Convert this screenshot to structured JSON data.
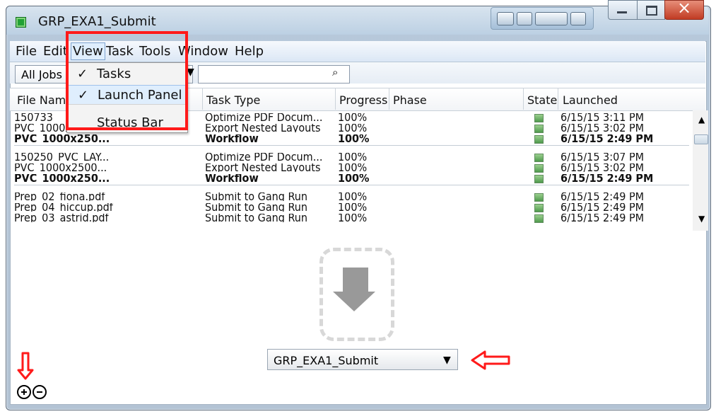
{
  "window": {
    "title": "GRP_EXA1_Submit"
  },
  "menubar": {
    "items": [
      "File",
      "Edit",
      "View",
      "Task",
      "Tools",
      "Window",
      "Help"
    ]
  },
  "toolbar": {
    "jobs_filter": "All Jobs",
    "search_value": ""
  },
  "columns": [
    "File Name",
    "Task Type",
    "Progress",
    "Phase",
    "State",
    "Launched"
  ],
  "rows": [
    {
      "file": "150733_",
      "task": "Optimize PDF Docum...",
      "progress": "100%",
      "launched": "6/15/15 3:11 PM",
      "bold": false
    },
    {
      "file": "PVC_1000x2500...",
      "task": "Export Nested Layouts",
      "progress": "100%",
      "launched": "6/15/15 3:02 PM",
      "bold": false
    },
    {
      "file": "PVC_1000x250...",
      "task": "Workflow",
      "progress": "100%",
      "launched": "6/15/15 2:49 PM",
      "bold": true
    },
    {
      "file": "150250_PVC_LAY...",
      "task": "Optimize PDF Docum...",
      "progress": "100%",
      "launched": "6/15/15 3:07 PM",
      "bold": false
    },
    {
      "file": "PVC_1000x2500...",
      "task": "Export Nested Layouts",
      "progress": "100%",
      "launched": "6/15/15 3:02 PM",
      "bold": false
    },
    {
      "file": "PVC_1000x250...",
      "task": "Workflow",
      "progress": "100%",
      "launched": "6/15/15 2:49 PM",
      "bold": true
    },
    {
      "file": "Prep_02_fiona.pdf",
      "task": "Submit to Gang Run",
      "progress": "100%",
      "launched": "6/15/15 2:49 PM",
      "bold": false
    },
    {
      "file": "Prep_04_hiccup.pdf",
      "task": "Submit to Gang Run",
      "progress": "100%",
      "launched": "6/15/15 2:49 PM",
      "bold": false
    },
    {
      "file": "Prep_03_astrid.pdf",
      "task": "Submit to Gang Run",
      "progress": "100%",
      "launched": "6/15/15 2:49 PM",
      "bold": false
    }
  ],
  "view_menu": {
    "items": [
      {
        "label": "Tasks",
        "checked": true
      },
      {
        "label": "Launch Panel",
        "checked": true
      },
      {
        "label": "Status Bar",
        "checked": false
      }
    ]
  },
  "launch_panel": {
    "selected": "GRP_EXA1_Submit"
  },
  "icons": {
    "app": "app-icon",
    "search": "search-icon",
    "dropdown": "chevron-down-icon",
    "state": "checkbox-icon",
    "add": "plus-circle-icon",
    "remove": "minus-circle-icon",
    "drop": "download-arrow-icon"
  },
  "colors": {
    "highlight_red": "#ff1a1a",
    "title_blue": "#b7c8da"
  }
}
